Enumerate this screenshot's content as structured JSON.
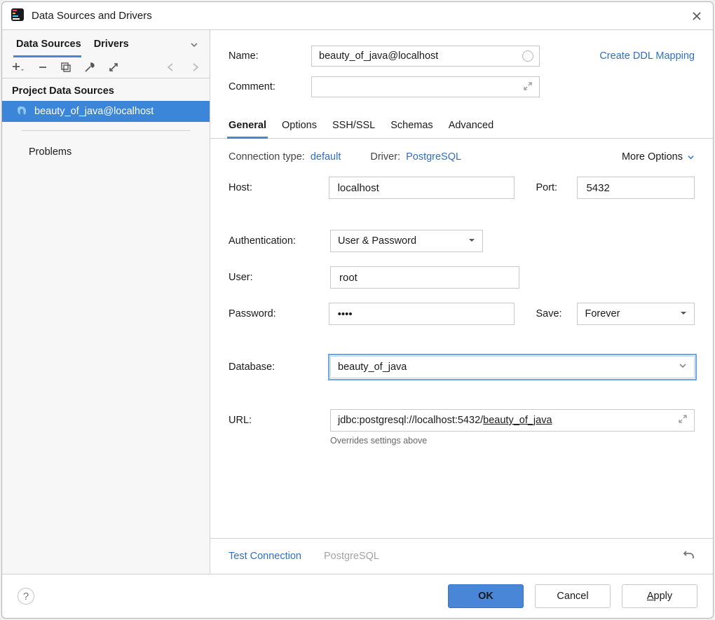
{
  "window": {
    "title": "Data Sources and Drivers"
  },
  "sidebar": {
    "tabs": {
      "data_sources": "Data Sources",
      "drivers": "Drivers"
    },
    "section_header": "Project Data Sources",
    "items": [
      {
        "label": "beauty_of_java@localhost"
      }
    ],
    "problems_label": "Problems"
  },
  "form": {
    "name": {
      "label": "Name:",
      "value": "beauty_of_java@localhost"
    },
    "comment": {
      "label": "Comment:",
      "value": ""
    },
    "ddl_link": "Create DDL Mapping"
  },
  "main_tabs": {
    "general": "General",
    "options": "Options",
    "sshssl": "SSH/SSL",
    "schemas": "Schemas",
    "advanced": "Advanced"
  },
  "general": {
    "conn_type_label": "Connection type:",
    "conn_type_value": "default",
    "driver_label": "Driver:",
    "driver_value": "PostgreSQL",
    "more_options": "More Options",
    "host": {
      "label": "Host:",
      "value": "localhost"
    },
    "port": {
      "label": "Port:",
      "value": "5432"
    },
    "auth": {
      "label": "Authentication:",
      "value": "User & Password"
    },
    "user": {
      "label": "User:",
      "value": "root"
    },
    "password": {
      "label": "Password:",
      "value": "••••"
    },
    "save": {
      "label": "Save:",
      "value": "Forever"
    },
    "database": {
      "label": "Database:",
      "value": "beauty_of_java"
    },
    "url": {
      "label": "URL:",
      "prefix": "jdbc:postgresql://localhost:5432/",
      "suffix": "beauty_of_java"
    },
    "url_hint": "Overrides settings above"
  },
  "footer_strip": {
    "test_connection": "Test Connection",
    "driver_name": "PostgreSQL"
  },
  "buttons": {
    "ok": "OK",
    "cancel": "Cancel",
    "apply": "Apply"
  }
}
